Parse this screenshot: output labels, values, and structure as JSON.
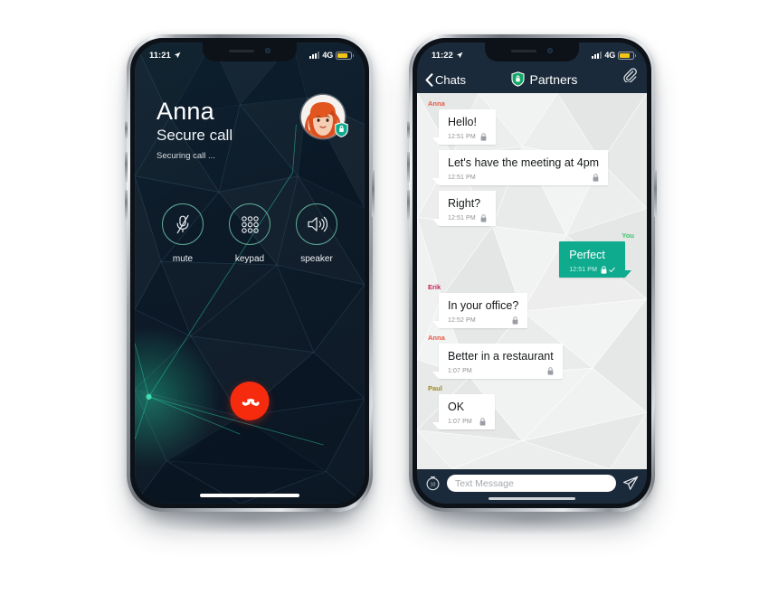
{
  "call_screen": {
    "status_bar": {
      "time": "11:21",
      "network": "4G",
      "location_icon": "location-arrow-icon"
    },
    "contact_name": "Anna",
    "call_type": "Secure call",
    "call_status": "Securing call ...",
    "avatar_alt": "Anna avatar",
    "security_badge_icon": "shield-lock-icon",
    "controls": [
      {
        "label": "mute",
        "icon": "microphone-muted-icon"
      },
      {
        "label": "keypad",
        "icon": "keypad-grid-icon"
      },
      {
        "label": "speaker",
        "icon": "speaker-waves-icon"
      }
    ],
    "end_call": {
      "label": "End call",
      "icon": "phone-hangup-icon",
      "color": "#f62b0e"
    }
  },
  "chat_screen": {
    "status_bar": {
      "time": "11:22",
      "network": "4G",
      "location_icon": "location-arrow-icon"
    },
    "nav": {
      "back_label": "Chats",
      "back_icon": "chevron-left-icon",
      "shield_icon": "shield-lock-icon",
      "title": "Partners",
      "attach_icon": "paperclip-icon"
    },
    "senders": {
      "anna_color": "#e8573f",
      "erik_color": "#c32452",
      "paul_color": "#9a8b21",
      "you_color": "#3ec46d"
    },
    "messages": [
      {
        "sender": "Anna",
        "text": "Hello!",
        "time": "12:51 PM",
        "direction": "in",
        "lock_icon": "lock-icon"
      },
      {
        "sender": "",
        "text": "Let's have the meeting at 4pm",
        "time": "12:51 PM",
        "direction": "in",
        "lock_icon": "lock-icon"
      },
      {
        "sender": "",
        "text": "Right?",
        "time": "12:51 PM",
        "direction": "in",
        "lock_icon": "lock-icon"
      },
      {
        "sender": "You",
        "text": "Perfect",
        "time": "12:51 PM",
        "direction": "out",
        "lock_icon": "lock-icon",
        "status_icon": "check-icon"
      },
      {
        "sender": "Erik",
        "text": "In your office?",
        "time": "12:52 PM",
        "direction": "in",
        "lock_icon": "lock-icon"
      },
      {
        "sender": "Anna",
        "text": "Better in a restaurant",
        "time": "1:07 PM",
        "direction": "in",
        "lock_icon": "lock-icon"
      },
      {
        "sender": "Paul",
        "text": "OK",
        "time": "1:07 PM",
        "direction": "in",
        "lock_icon": "lock-icon"
      }
    ],
    "input_bar": {
      "timer_icon": "self-destruct-timer-icon",
      "timer_value": "10",
      "placeholder": "Text Message",
      "value": "",
      "send_icon": "send-paper-plane-icon"
    },
    "bubble_colors": {
      "incoming": "#ffffff",
      "outgoing": "#0fab8e"
    }
  }
}
